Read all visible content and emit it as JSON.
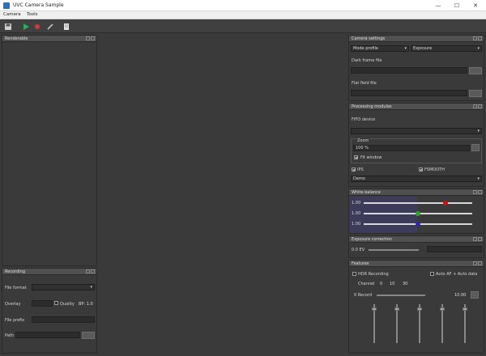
{
  "window": {
    "title": "UVC Camera Sample",
    "min": "—",
    "max": "☐",
    "close": "✕"
  },
  "menu": {
    "items": [
      "Camera",
      "Tools"
    ]
  },
  "toolbar": {
    "icons": [
      "save-icon",
      "play-icon",
      "stop-icon",
      "edit-icon",
      "document-icon"
    ]
  },
  "colors": {
    "play": "#1fb35a",
    "stop": "#d23a3a",
    "wb_red": "#cc1111",
    "wb_green": "#2ea52e",
    "wb_blue": "#2a2aaa",
    "wb_bg": "#3c3c5a"
  },
  "panels": {
    "viewer": {
      "title": "Renderable"
    },
    "recording": {
      "title": "Recording",
      "file_format_label": "File format",
      "codec_label": "Overlay",
      "quality_label": "Quality",
      "quality_value": "BP: 1.0",
      "file_path_label": "File prefix",
      "path_label": "Path"
    },
    "camera_settings": {
      "title": "Camera settings",
      "mode_value": "Mode profile",
      "exposure_mode_value": "Exposure",
      "dark_frame_label": "Dark frame file",
      "flat_field_label": "Flat field file"
    },
    "processing": {
      "title": "Processing modules",
      "fifo_label": "FIFO device",
      "zoom_group_label": "Zoom",
      "zoom_value": "100",
      "zoom_unit": "%",
      "fit_window_label": "Fit window",
      "ips_label": "IPS",
      "fill_label": "FSMOOTH",
      "mode_value": "Demo"
    },
    "white_balance": {
      "title": "White balance",
      "red_label": "1.00",
      "green_label": "1.00",
      "blue_label": "1.00",
      "red_level": 0.75,
      "green_level": 0.5,
      "blue_level": 0.5
    },
    "exposure": {
      "title": "Exposure correction",
      "value_label": "0.0 EV"
    },
    "features": {
      "title": "Features",
      "hdr_label": "HDR Recording",
      "auto_label": "Auto AF + Auto data",
      "channel_label": "Channel",
      "channel_values": [
        "0",
        "10",
        "30"
      ],
      "slider_label": "0 Record",
      "slider_value": "10.00"
    }
  }
}
